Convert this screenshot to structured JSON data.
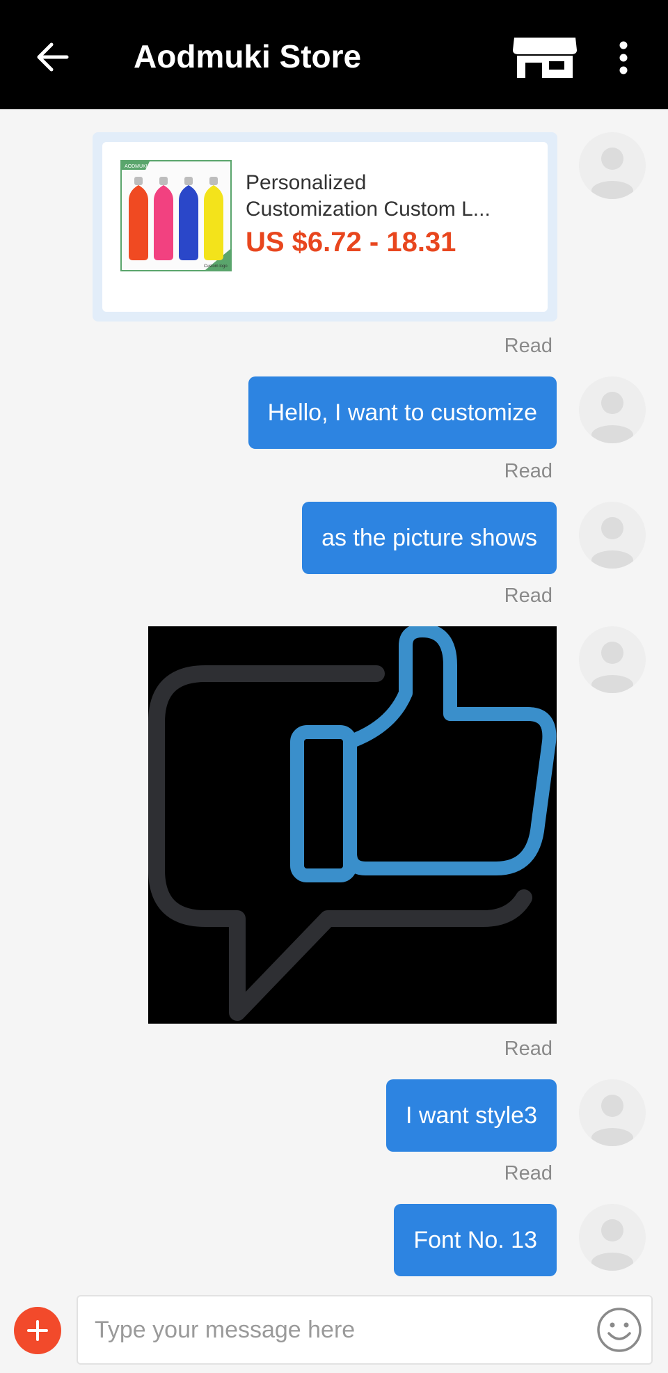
{
  "header": {
    "title": "Aodmuki Store",
    "back_icon": "arrow-left-icon",
    "store_icon": "store-icon",
    "more_icon": "more-vertical-icon"
  },
  "product": {
    "name_line1": "Personalized",
    "name_line2": "Customization Custom L...",
    "price": "US $6.72 - 18.31",
    "brand_mark": "AODMUKI",
    "thumb_caption": "Custom logo"
  },
  "messages": [
    {
      "type": "text",
      "text": "Hello, I want to customize",
      "status": "Read"
    },
    {
      "type": "text",
      "text": "as the picture shows",
      "status": "Read"
    },
    {
      "type": "image",
      "icon": "thumbs-up-chat-icon",
      "status": "Read"
    },
    {
      "type": "text",
      "text": "I want style3",
      "status": "Read"
    },
    {
      "type": "text",
      "text": "Font No. 13"
    }
  ],
  "product_status": "Read",
  "composer": {
    "placeholder": "Type your message here",
    "add_icon": "plus-icon",
    "emoji_icon": "smiley-icon"
  },
  "colors": {
    "header_bg": "#000000",
    "bubble": "#2d84e1",
    "price": "#e8461e",
    "add_button": "#f24a2b",
    "thumbs_up": "#3a8fcb"
  }
}
